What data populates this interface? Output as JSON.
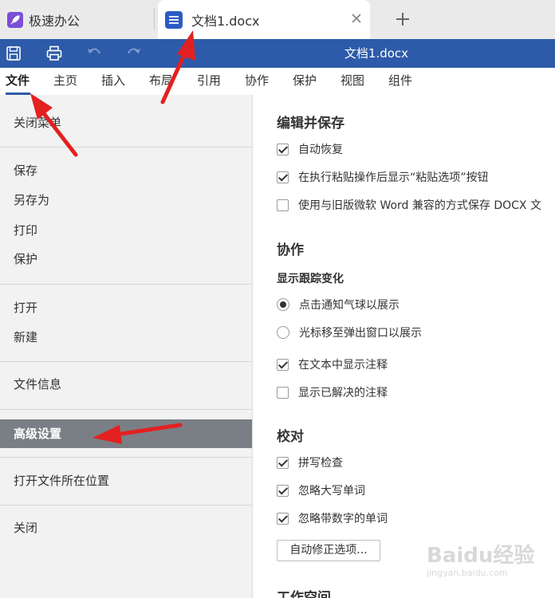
{
  "tabs": {
    "app_label": "极速办公",
    "doc_label": "文档1.docx"
  },
  "titlebar": {
    "title": "文档1.docx"
  },
  "ribbon": {
    "items": [
      "文件",
      "主页",
      "插入",
      "布局",
      "引用",
      "协作",
      "保护",
      "视图",
      "组件"
    ]
  },
  "file_menu": {
    "close_menu": "关闭菜单",
    "save": "保存",
    "save_as": "另存为",
    "print": "打印",
    "protect": "保护",
    "open": "打开",
    "new": "新建",
    "file_info": "文件信息",
    "advanced_settings": "高级设置",
    "open_location": "打开文件所在位置",
    "close": "关闭"
  },
  "settings": {
    "edit_save": {
      "heading": "编辑并保存",
      "options": [
        {
          "label": "自动恢复",
          "checked": true
        },
        {
          "label": "在执行粘贴操作后显示“粘贴选项”按钮",
          "checked": true
        },
        {
          "label": "使用与旧版微软 Word 兼容的方式保存 DOCX 文",
          "checked": false
        }
      ]
    },
    "collab": {
      "heading": "协作",
      "subheading": "显示跟踪变化",
      "radios": [
        {
          "label": "点击通知气球以展示",
          "checked": true
        },
        {
          "label": "光标移至弹出窗口以展示",
          "checked": false
        }
      ],
      "options": [
        {
          "label": "在文本中显示注释",
          "checked": true
        },
        {
          "label": "显示已解决的注释",
          "checked": false
        }
      ]
    },
    "proofing": {
      "heading": "校对",
      "options": [
        {
          "label": "拼写检查",
          "checked": true
        },
        {
          "label": "忽略大写单词",
          "checked": true
        },
        {
          "label": "忽略带数字的单词",
          "checked": true
        }
      ],
      "autocorrect_button": "自动修正选项..."
    },
    "workspace": {
      "heading": "工作空间"
    }
  },
  "watermark": {
    "brand": "Baidu经验",
    "url": "jingyan.baidu.com"
  },
  "colors": {
    "titlebar": "#2d5ba9",
    "selected_menu": "#7a7f85",
    "annotation_arrow": "#e32020"
  }
}
